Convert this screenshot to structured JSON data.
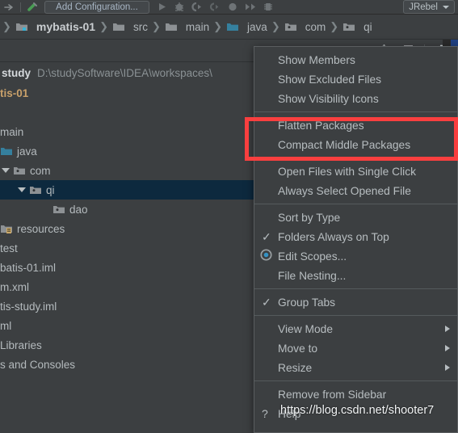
{
  "toolbar": {
    "icons": [
      "arrow-right-icon",
      "divider",
      "hammer-build-icon"
    ],
    "run_configuration_label": "Add Configuration...",
    "run_icon": "run-play-icon",
    "debug_icon": "debug-bug-icon",
    "run_coverage_icon": "run-coverage-icon",
    "profile_icon": "run-profile-icon",
    "stop_icon": "stop-icon",
    "step_icon": "step-over-icon",
    "attach_icon": "attach-process-icon",
    "jrebel_label": "JRebel"
  },
  "breadcrumb": {
    "sep": "❯",
    "items": [
      {
        "label": "mybatis-01",
        "icon": "module-folder-icon",
        "root": true
      },
      {
        "label": "src",
        "icon": "folder-icon",
        "root": false
      },
      {
        "label": "main",
        "icon": "folder-icon",
        "root": false
      },
      {
        "label": "java",
        "icon": "source-root-folder-icon",
        "root": false
      },
      {
        "label": "com",
        "icon": "package-folder-icon",
        "root": false
      },
      {
        "label": "qi",
        "icon": "package-folder-icon",
        "root": false
      }
    ]
  },
  "tool_window": {
    "icons": [
      "select-opened-file-icon",
      "collapse-all-icon",
      "settings-gear-icon"
    ]
  },
  "path_row": {
    "project_label": "study",
    "path": "D:\\studySoftware\\IDEA\\workspaces\\"
  },
  "tree": {
    "rows": [
      {
        "label": "tis-01",
        "indent": 0,
        "icon": "none",
        "arrow": false,
        "selected": false,
        "bold": true
      },
      {
        "label": "",
        "indent": 0,
        "icon": "none",
        "arrow": false,
        "selected": false,
        "bold": false
      },
      {
        "label": "main",
        "indent": 0,
        "icon": "none",
        "arrow": false,
        "selected": false,
        "bold": false
      },
      {
        "label": "java",
        "indent": 0,
        "icon": "source-root-folder-icon",
        "arrow": false,
        "selected": false,
        "bold": false
      },
      {
        "label": "com",
        "indent": 0,
        "icon": "package-folder-icon",
        "arrow": true,
        "selected": false,
        "bold": false
      },
      {
        "label": "qi",
        "indent": 20,
        "icon": "package-folder-icon",
        "arrow": true,
        "selected": true,
        "bold": false
      },
      {
        "label": "dao",
        "indent": 52,
        "icon": "package-folder-icon",
        "arrow": false,
        "selected": false,
        "bold": false
      },
      {
        "label": "resources",
        "indent": 0,
        "icon": "resource-root-folder-icon",
        "arrow": false,
        "selected": false,
        "bold": false
      },
      {
        "label": "test",
        "indent": 0,
        "icon": "none",
        "arrow": false,
        "selected": false,
        "bold": false
      },
      {
        "label": "batis-01.iml",
        "indent": 0,
        "icon": "none",
        "arrow": false,
        "selected": false,
        "bold": false
      },
      {
        "label": "m.xml",
        "indent": 0,
        "icon": "none",
        "arrow": false,
        "selected": false,
        "bold": false
      },
      {
        "label": "tis-study.iml",
        "indent": 0,
        "icon": "none",
        "arrow": false,
        "selected": false,
        "bold": false
      },
      {
        "label": "ml",
        "indent": 0,
        "icon": "none",
        "arrow": false,
        "selected": false,
        "bold": false
      },
      {
        "label": "Libraries",
        "indent": 0,
        "icon": "none",
        "arrow": false,
        "selected": false,
        "bold": false
      },
      {
        "label": "s and Consoles",
        "indent": 0,
        "icon": "none",
        "arrow": false,
        "selected": false,
        "bold": false
      }
    ]
  },
  "context_menu": {
    "items": [
      {
        "type": "item",
        "label": "Show Members",
        "mark": "none"
      },
      {
        "type": "item",
        "label": "Show Excluded Files",
        "mark": "none"
      },
      {
        "type": "item",
        "label": "Show Visibility Icons",
        "mark": "none"
      },
      {
        "type": "separator"
      },
      {
        "type": "item",
        "label": "Flatten Packages",
        "mark": "none"
      },
      {
        "type": "item",
        "label": "Compact Middle Packages",
        "mark": "none"
      },
      {
        "type": "separator"
      },
      {
        "type": "item",
        "label": "Open Files with Single Click",
        "mark": "none"
      },
      {
        "type": "item",
        "label": "Always Select Opened File",
        "mark": "none"
      },
      {
        "type": "separator"
      },
      {
        "type": "item",
        "label": "Sort by Type",
        "mark": "none"
      },
      {
        "type": "item",
        "label": "Folders Always on Top",
        "mark": "check"
      },
      {
        "type": "item",
        "label": "Edit Scopes...",
        "mark": "radio"
      },
      {
        "type": "item",
        "label": "File Nesting...",
        "mark": "none"
      },
      {
        "type": "separator"
      },
      {
        "type": "item",
        "label": "Group Tabs",
        "mark": "check"
      },
      {
        "type": "separator"
      },
      {
        "type": "submenu",
        "label": "View Mode",
        "mark": "none"
      },
      {
        "type": "submenu",
        "label": "Move to",
        "mark": "none"
      },
      {
        "type": "submenu",
        "label": "Resize",
        "mark": "none"
      },
      {
        "type": "separator"
      },
      {
        "type": "item",
        "label": "Remove from Sidebar",
        "mark": "none"
      },
      {
        "type": "item",
        "label": "Help",
        "mark": "question"
      }
    ]
  },
  "annotation": {
    "highlight_color": "#f93f3f",
    "highlight_targets": [
      "Flatten Packages",
      "Compact Middle Packages"
    ]
  },
  "watermark": {
    "text": "https://blog.csdn.net/shooter7"
  },
  "colors": {
    "background": "#3c3f41",
    "menu_background": "#3c3f41",
    "selection": "#0d293e",
    "text": "#b7bdc0",
    "accent_red": "#f93f3f",
    "editor_selection_blue": "#214283"
  }
}
